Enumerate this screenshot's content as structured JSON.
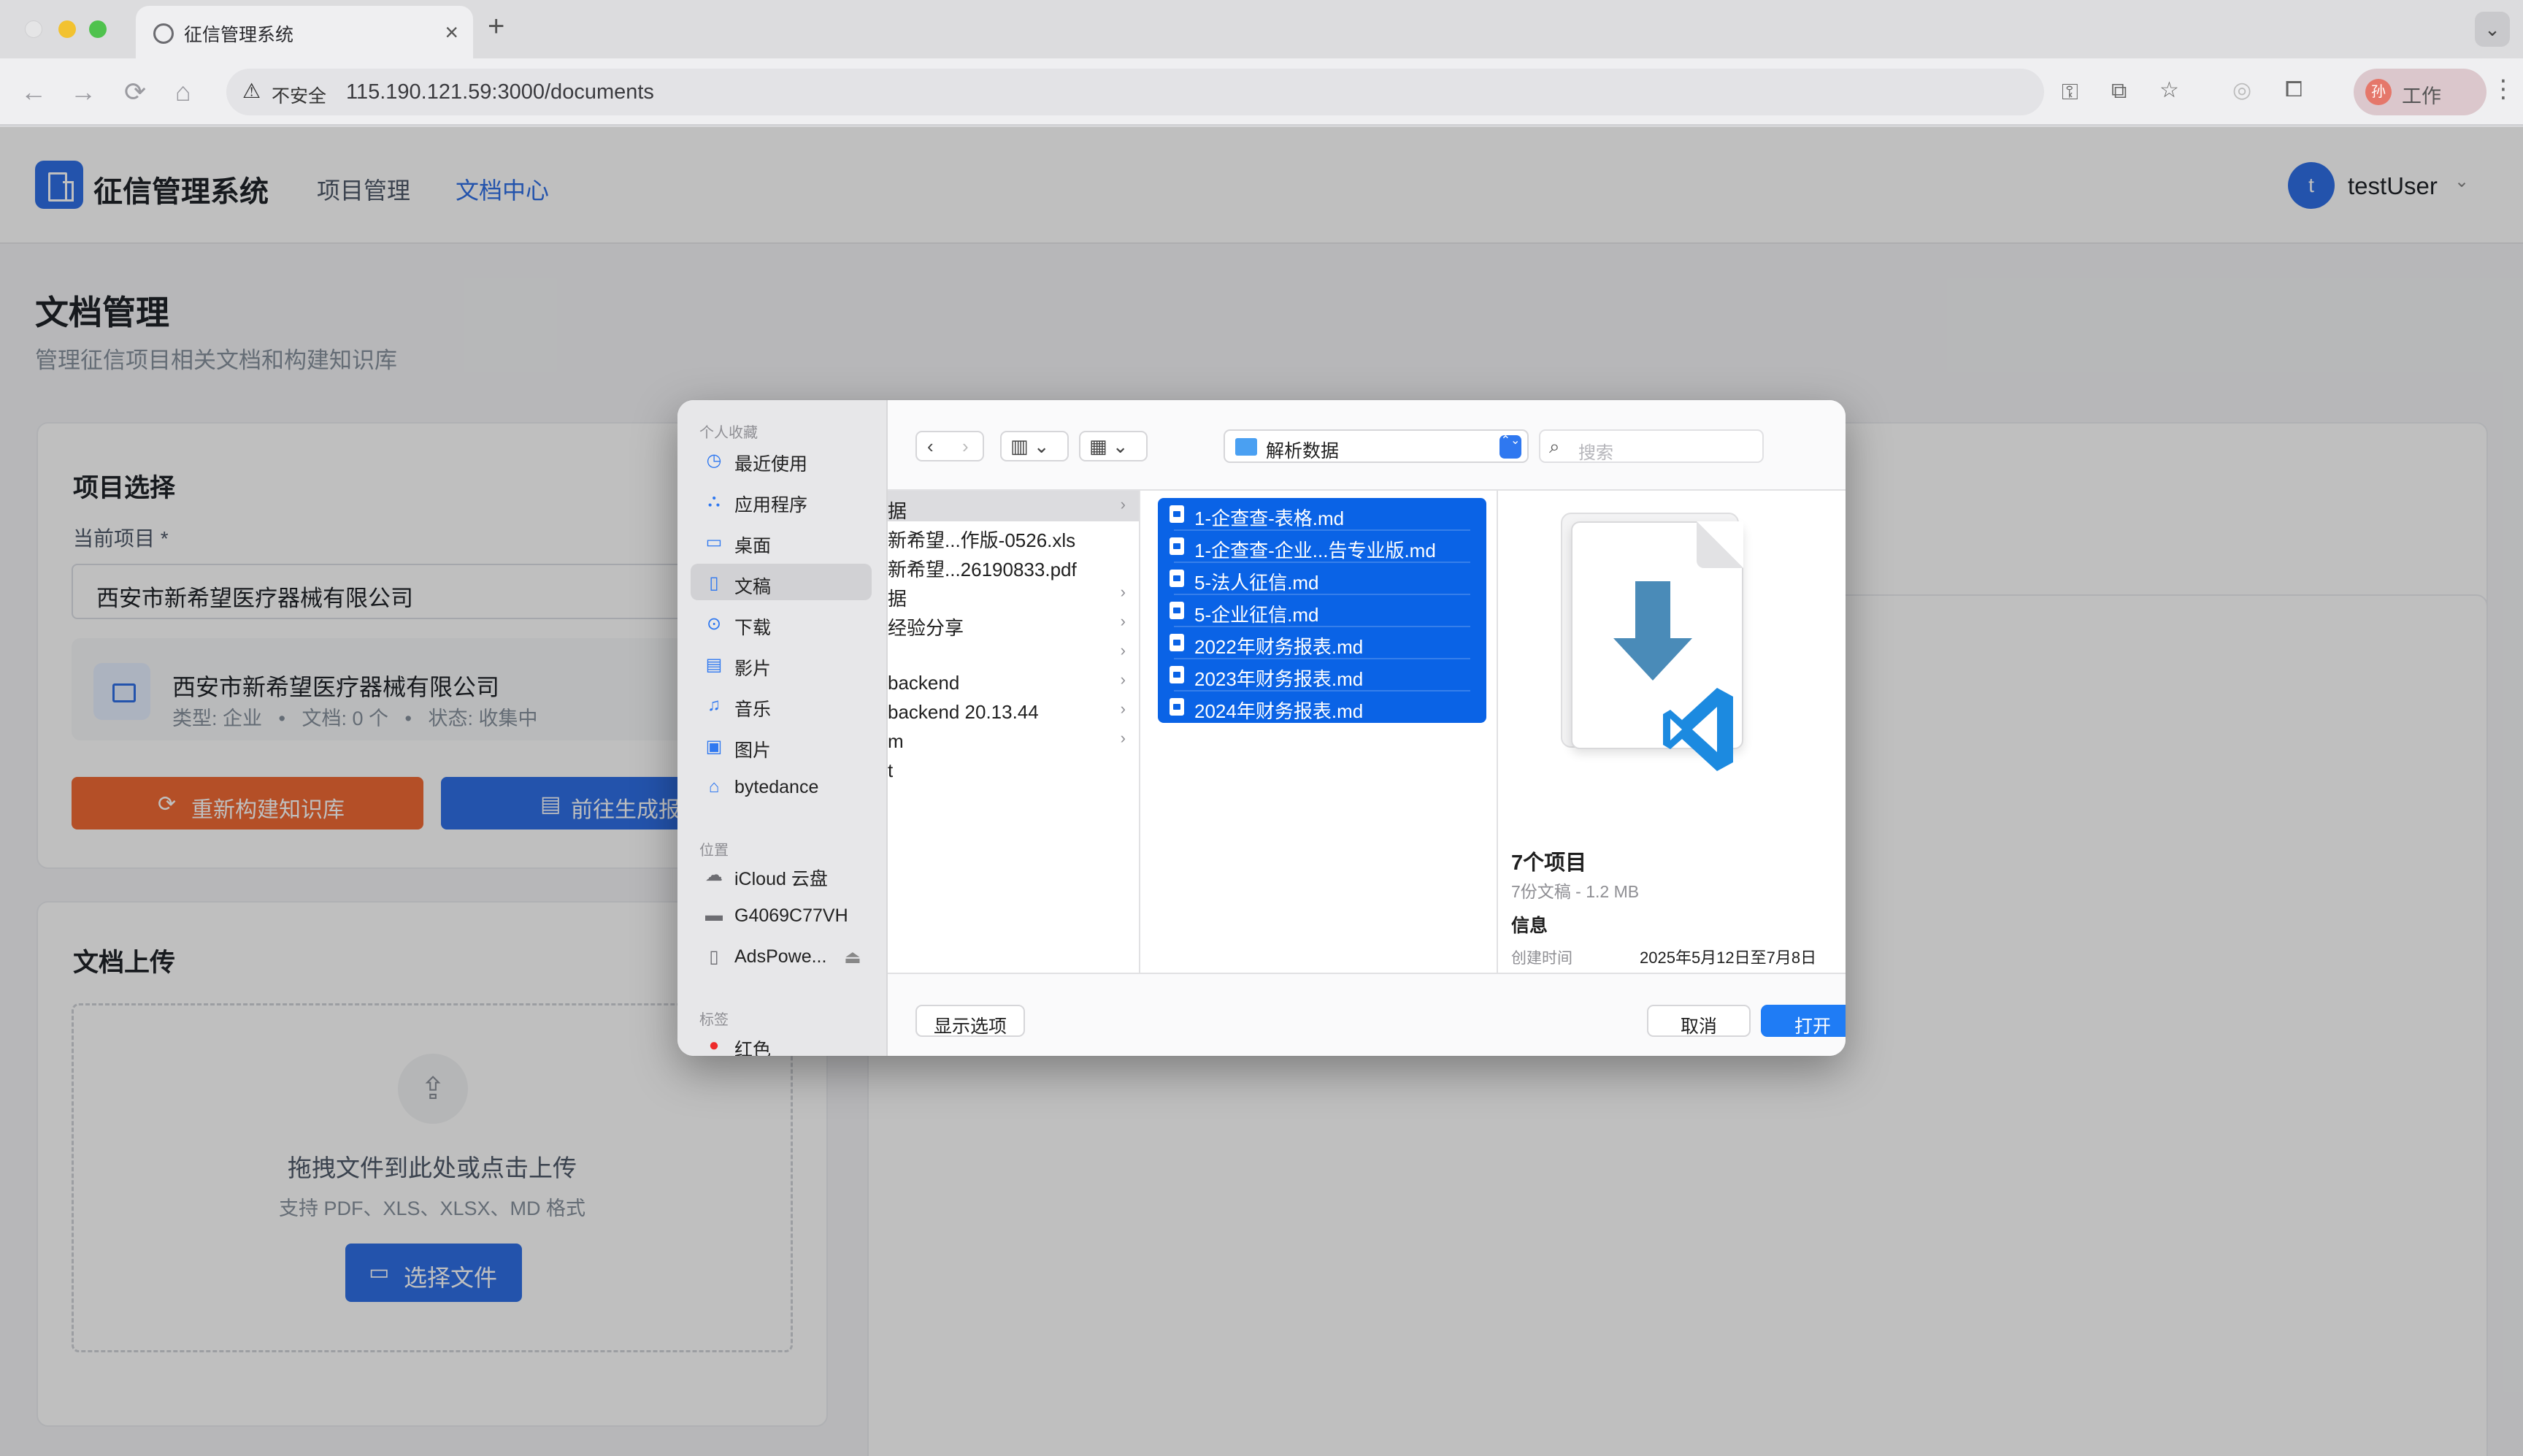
{
  "browser": {
    "tab_title": "征信管理系统",
    "tab_close": "×",
    "new_tab": "+",
    "tab_menu": "⌄",
    "nav": {
      "back": "←",
      "forward": "→",
      "reload": "⟳",
      "home": "⌂"
    },
    "omnibox": {
      "warning_icon": "⚠",
      "insecure_label": "不安全",
      "url": "115.190.121.59:3000/documents"
    },
    "toolbar_icons": [
      "key-icon",
      "translate-icon",
      "star-icon",
      "extension-icon",
      "puzzle-icon"
    ],
    "profile": {
      "avatar": "孙",
      "label": "工作"
    },
    "menu": "⋮"
  },
  "app": {
    "title": "征信管理系统",
    "nav": [
      {
        "label": "项目管理"
      },
      {
        "label": "文档中心"
      }
    ],
    "user": {
      "avatar": "t",
      "name": "testUser",
      "caret": "⌄"
    }
  },
  "page": {
    "title": "文档管理",
    "subtitle": "管理征信项目相关文档和构建知识库"
  },
  "project_select": {
    "title": "项目选择",
    "field_label": "当前项目 *",
    "selected_value": "西安市新希望医疗器械有限公司",
    "project_card": {
      "name": "西安市新希望医疗器械有限公司",
      "meta": "类型: 企业   •   文档: 0 个   •   状态: 收集中"
    },
    "rebuild_button": "重新构建知识库",
    "report_button": "前往生成报告"
  },
  "upload": {
    "title": "文档上传",
    "hint": "拖拽文件到此处或点击上传",
    "formats": "支持 PDF、XLS、XLSX、MD 格式",
    "button": "选择文件"
  },
  "dialog": {
    "sidebar": {
      "favorites_header": "个人收藏",
      "favorites": [
        {
          "label": "最近使用",
          "icon": "clock-icon",
          "glyph": "◷"
        },
        {
          "label": "应用程序",
          "icon": "apps-icon",
          "glyph": "⛬"
        },
        {
          "label": "桌面",
          "icon": "desktop-icon",
          "glyph": "▭"
        },
        {
          "label": "文稿",
          "icon": "document-icon",
          "glyph": "▯",
          "selected": true
        },
        {
          "label": "下载",
          "icon": "download-icon",
          "glyph": "⊙"
        },
        {
          "label": "影片",
          "icon": "film-icon",
          "glyph": "▤"
        },
        {
          "label": "音乐",
          "icon": "music-icon",
          "glyph": "♫"
        },
        {
          "label": "图片",
          "icon": "photo-icon",
          "glyph": "▣"
        },
        {
          "label": "bytedance",
          "icon": "home-icon",
          "glyph": "⌂"
        }
      ],
      "locations_header": "位置",
      "locations": [
        {
          "label": "iCloud 云盘",
          "icon": "cloud-icon",
          "glyph": "☁"
        },
        {
          "label": "G4069C77VH",
          "icon": "laptop-icon",
          "glyph": "▬"
        },
        {
          "label": "AdsPowe...",
          "icon": "disk-icon",
          "glyph": "▯",
          "eject": "⏏"
        }
      ],
      "tags_header": "标签",
      "tags": [
        {
          "label": "红色",
          "icon": "red-tag-icon",
          "glyph": "●"
        }
      ]
    },
    "toolbar": {
      "back": "‹",
      "forward": "›",
      "view_columns": "▥ ⌄",
      "view_grid": "▦ ⌄",
      "location": "解析数据",
      "stepper": "⌃⌄",
      "search_placeholder": "搜索",
      "search_icon": "⌕"
    },
    "column1": [
      {
        "label": "据",
        "arrow": "›",
        "highlight": true
      },
      {
        "label": "新希望...作版-0526.xls",
        "arrow": ""
      },
      {
        "label": "新希望...26190833.pdf",
        "arrow": ""
      },
      {
        "label": "据",
        "arrow": "›"
      },
      {
        "label": "经验分享",
        "arrow": "›"
      },
      {
        "label": "",
        "arrow": "›"
      },
      {
        "label": "backend",
        "arrow": "›"
      },
      {
        "label": "backend 20.13.44",
        "arrow": "›"
      },
      {
        "label": "m",
        "arrow": "›"
      },
      {
        "label": "t",
        "arrow": ""
      }
    ],
    "column2": [
      {
        "label": "1-企查查-表格.md"
      },
      {
        "label": "1-企查查-企业...告专业版.md"
      },
      {
        "label": "5-法人征信.md"
      },
      {
        "label": "5-企业征信.md"
      },
      {
        "label": "2022年财务报表.md"
      },
      {
        "label": "2023年财务报表.md"
      },
      {
        "label": "2024年财务报表.md"
      }
    ],
    "preview": {
      "title": "7个项目",
      "subtitle": "7份文稿 - 1.2 MB",
      "info_header": "信息",
      "created_label": "创建时间",
      "created_value": "2025年5月12日至7月8日"
    },
    "buttons": {
      "options": "显示选项",
      "cancel": "取消",
      "open": "打开"
    }
  },
  "colors": {
    "accent": "#2f6fe6",
    "selection": "#0a63e6",
    "orange": "#f06a35"
  }
}
